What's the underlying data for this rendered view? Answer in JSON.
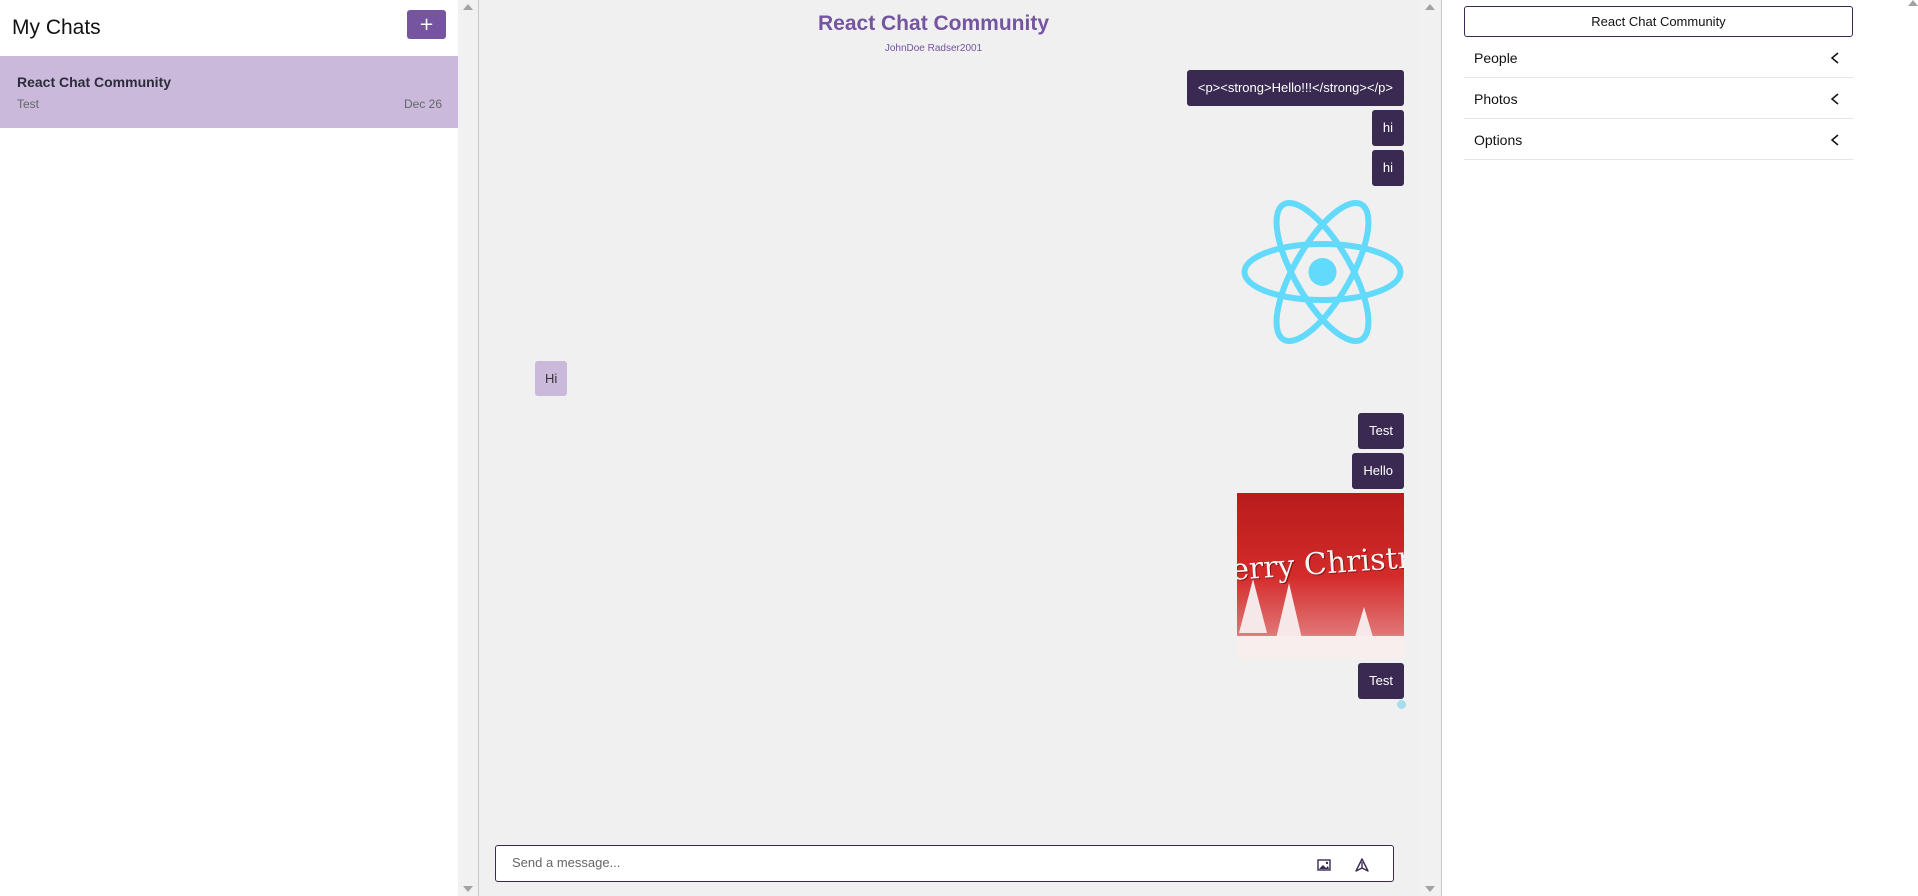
{
  "sidebar": {
    "title": "My Chats",
    "new_chat_label": "+",
    "chats": [
      {
        "title": "React Chat Community",
        "last_message": "Test",
        "date": "Dec 26"
      }
    ]
  },
  "chat": {
    "title": "React Chat Community",
    "subtitle": "JohnDoe Radser2001",
    "messages": [
      {
        "type": "text",
        "sender": "me",
        "text": "<p><strong>Hello!!!</strong></p>"
      },
      {
        "type": "text",
        "sender": "me",
        "text": "hi"
      },
      {
        "type": "text",
        "sender": "me",
        "text": "hi"
      },
      {
        "type": "image",
        "sender": "me",
        "image": "react-logo"
      },
      {
        "type": "text",
        "sender": "other",
        "text": "Hi"
      },
      {
        "type": "text",
        "sender": "me",
        "text": "Test"
      },
      {
        "type": "text",
        "sender": "me",
        "text": "Hello"
      },
      {
        "type": "image",
        "sender": "me",
        "image": "merry-christmas",
        "caption": "erry Christmas"
      },
      {
        "type": "text",
        "sender": "me",
        "text": "Test"
      }
    ],
    "composer": {
      "placeholder": "Send a message..."
    }
  },
  "settings": {
    "title": "React Chat Community",
    "sections": [
      "People",
      "Photos",
      "Options"
    ]
  },
  "colors": {
    "accent": "#7554a0",
    "my_bubble": "#3a2a52",
    "their_bubble": "#cbb9dc",
    "selected_chat": "#cbb9dc",
    "react_blue": "#61dafb"
  }
}
